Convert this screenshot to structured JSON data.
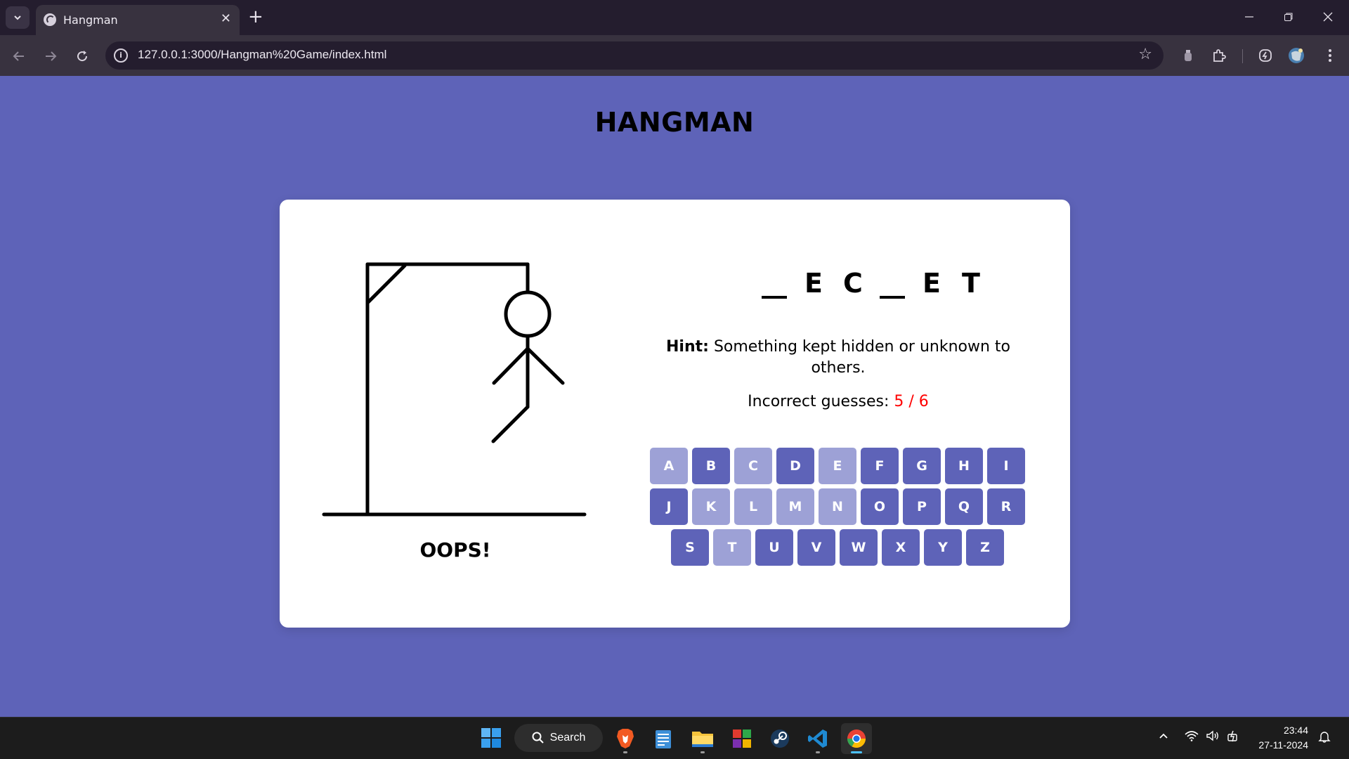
{
  "browser": {
    "tab_title": "Hangman",
    "url": "127.0.0.1:3000/Hangman%20Game/index.html"
  },
  "page": {
    "title": "HANGMAN",
    "word_slots": [
      "",
      "E",
      "C",
      "",
      "E",
      "T"
    ],
    "hint_label": "Hint:",
    "hint_text": "Something kept hidden or unknown to others.",
    "guesses_label": "Incorrect guesses:",
    "guesses_value": "5 / 6",
    "result_text": "OOPS!",
    "keyboard_rows": [
      [
        {
          "letter": "A",
          "used": true
        },
        {
          "letter": "B",
          "used": false
        },
        {
          "letter": "C",
          "used": true
        },
        {
          "letter": "D",
          "used": false
        },
        {
          "letter": "E",
          "used": true
        },
        {
          "letter": "F",
          "used": false
        },
        {
          "letter": "G",
          "used": false
        },
        {
          "letter": "H",
          "used": false
        },
        {
          "letter": "I",
          "used": false
        }
      ],
      [
        {
          "letter": "J",
          "used": false
        },
        {
          "letter": "K",
          "used": true
        },
        {
          "letter": "L",
          "used": true
        },
        {
          "letter": "M",
          "used": true
        },
        {
          "letter": "N",
          "used": true
        },
        {
          "letter": "O",
          "used": false
        },
        {
          "letter": "P",
          "used": false
        },
        {
          "letter": "Q",
          "used": false
        },
        {
          "letter": "R",
          "used": false
        }
      ],
      [
        {
          "letter": "S",
          "used": false
        },
        {
          "letter": "T",
          "used": true
        },
        {
          "letter": "U",
          "used": false
        },
        {
          "letter": "V",
          "used": false
        },
        {
          "letter": "W",
          "used": false
        },
        {
          "letter": "X",
          "used": false
        },
        {
          "letter": "Y",
          "used": false
        },
        {
          "letter": "Z",
          "used": false
        }
      ]
    ],
    "colors": {
      "background": "#5e63b8",
      "key_active": "#5e63b8",
      "key_used": "#9da1d6",
      "guess_count": "#ff0000"
    }
  },
  "taskbar": {
    "search_label": "Search",
    "apps": [
      "brave-icon",
      "notepad-icon",
      "file-explorer-icon",
      "app-tiles-icon",
      "steam-icon",
      "vscode-icon",
      "chrome-icon"
    ],
    "time": "23:44",
    "date": "27-11-2024"
  }
}
